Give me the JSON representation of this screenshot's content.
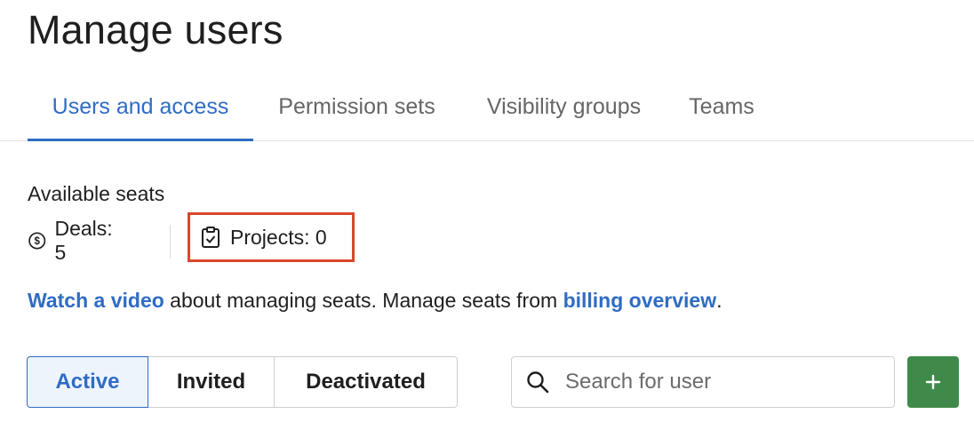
{
  "page": {
    "title": "Manage users"
  },
  "tabs": [
    {
      "label": "Users and access",
      "active": true
    },
    {
      "label": "Permission sets",
      "active": false
    },
    {
      "label": "Visibility groups",
      "active": false
    },
    {
      "label": "Teams",
      "active": false
    }
  ],
  "seats": {
    "heading": "Available seats",
    "deals": {
      "label": "Deals: 5",
      "icon": "dollar-circle-icon"
    },
    "projects": {
      "label": "Projects: 0",
      "icon": "clipboard-check-icon"
    }
  },
  "info": {
    "link1": "Watch a video",
    "middle": " about managing seats. Manage seats from ",
    "link2": "billing overview",
    "end": "."
  },
  "filters": [
    {
      "label": "Active",
      "active": true
    },
    {
      "label": "Invited",
      "active": false
    },
    {
      "label": "Deactivated",
      "active": false
    }
  ],
  "search": {
    "placeholder": "Search for user",
    "value": ""
  },
  "add_button": {
    "label": "+"
  },
  "colors": {
    "accent": "#2f6cc4",
    "highlight": "#d9472b",
    "add": "#3f8a4a"
  }
}
